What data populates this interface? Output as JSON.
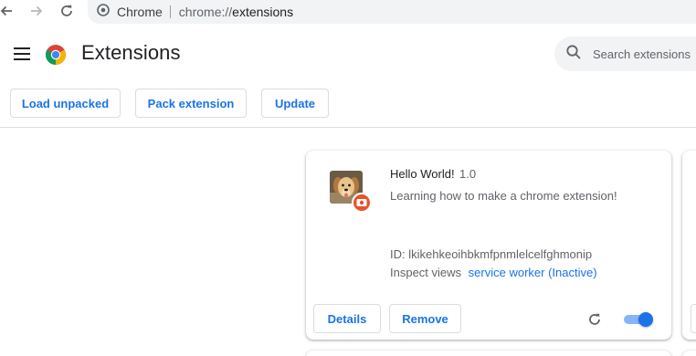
{
  "browser": {
    "site_label": "Chrome",
    "url_scheme": "chrome://",
    "url_host": "extensions",
    "icons": [
      "back-arrow-icon",
      "forward-arrow-icon",
      "reload-icon",
      "chrome-site-icon"
    ]
  },
  "header": {
    "title": "Extensions",
    "search_placeholder": "Search extensions",
    "icons": [
      "menu-icon",
      "chrome-logo",
      "search-icon"
    ]
  },
  "dev_toolbar": {
    "load_unpacked": "Load unpacked",
    "pack_extension": "Pack extension",
    "update": "Update"
  },
  "extensions": [
    {
      "name": "Hello World!",
      "version": "1.0",
      "description": "Learning how to make a chrome extension!",
      "id_label": "ID: lkikehkeoihbkmfpnmlelcelfghmonip",
      "inspect_label": "Inspect views",
      "inspect_link": "service worker (Inactive)",
      "details_label": "Details",
      "remove_label": "Remove",
      "enabled": true
    }
  ],
  "colors": {
    "accent": "#1a73e8",
    "toggle_track": "#8ab4f8",
    "badge": "#e8522a",
    "border": "#dadce0"
  }
}
